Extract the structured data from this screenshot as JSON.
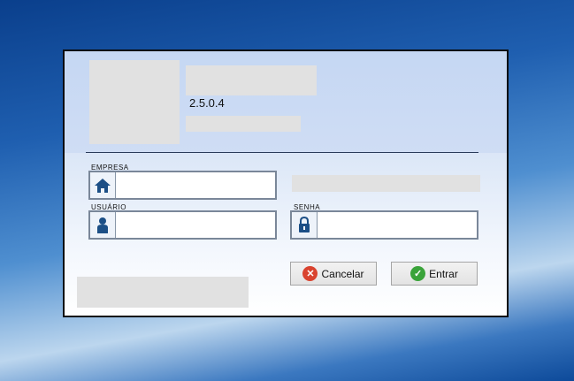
{
  "app": {
    "version": "2.5.0.4"
  },
  "form": {
    "empresa": {
      "label": "EMPRESA",
      "value": ""
    },
    "usuario": {
      "label": "USUÁRIO",
      "value": ""
    },
    "senha": {
      "label": "SENHA",
      "value": ""
    }
  },
  "buttons": {
    "cancel": "Cancelar",
    "enter": "Entrar"
  },
  "colors": {
    "icon": "#1c4f86",
    "cancel": "#d9432f",
    "enter": "#3aa33a"
  }
}
